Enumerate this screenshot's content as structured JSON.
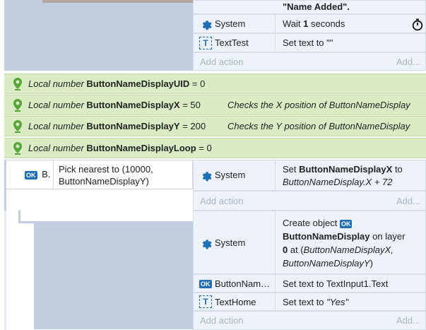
{
  "top_block": {
    "continuation_text": "\"Name Added\".",
    "rows": [
      {
        "object": "System",
        "action": "Wait ",
        "action_bold": "1",
        "action_tail": " seconds"
      },
      {
        "object": "TextTest",
        "action": "Set text to \"\""
      }
    ],
    "add_action": "Add action",
    "add_more": "Add..."
  },
  "variables": [
    {
      "prefix": "Local number ",
      "name": "ButtonNameDisplayUID",
      "value": " = 0",
      "comment": ""
    },
    {
      "prefix": "Local number ",
      "name": "ButtonNameDisplayX",
      "value": " = 50",
      "comment": "Checks the X position of ButtonNameDisplay"
    },
    {
      "prefix": "Local number ",
      "name": "ButtonNameDisplayY",
      "value": " = 200",
      "comment": "Checks the Y position of ButtonNameDisplay"
    },
    {
      "prefix": "Local number ",
      "name": "ButtonNameDisplayLoop",
      "value": " = 0",
      "comment": ""
    }
  ],
  "event_block": {
    "condition_object": "B.",
    "condition_text_line1": "Pick nearest to (10000,",
    "condition_text_line2": "ButtonNameDisplayY)",
    "action_object": "System",
    "action_line1_prefix": "Set ",
    "action_line1_bold": "ButtonNameDisplayX",
    "action_line1_suffix": " to",
    "action_line2": "ButtonNameDisplay.X + 72",
    "add_action": "Add action",
    "add_more": "Add..."
  },
  "sub_block": {
    "rows": [
      {
        "object": "System",
        "line1": "Create object ",
        "line2_bold": "ButtonNameDisplay",
        "line2_tail": " on layer",
        "line3_bold": "0",
        "line3_tail": " at (",
        "line3_italic": "ButtonNameDisplayX,",
        "line4_italic": "ButtonNameDisplayY",
        "line4_tail": ")"
      },
      {
        "object": "ButtonNam…",
        "action": "Set text to TextInput1.Text"
      },
      {
        "object": "TextHome",
        "action_prefix": "Set text to ",
        "action_italic": "\"Yes\""
      }
    ],
    "add_action": "Add action",
    "add_more": "Add..."
  },
  "icons": {
    "gear": "gear-icon",
    "text": "text-object-icon",
    "button": "button-object-icon",
    "pin": "local-variable-icon",
    "timer": "timer-icon"
  },
  "colors": {
    "block_bg": "#c2cee0",
    "cell_bg": "#eef2fa",
    "var_bg": "#d9ecc4",
    "accent_blue": "#1e6fb3",
    "pin_green": "#5aa53a"
  }
}
